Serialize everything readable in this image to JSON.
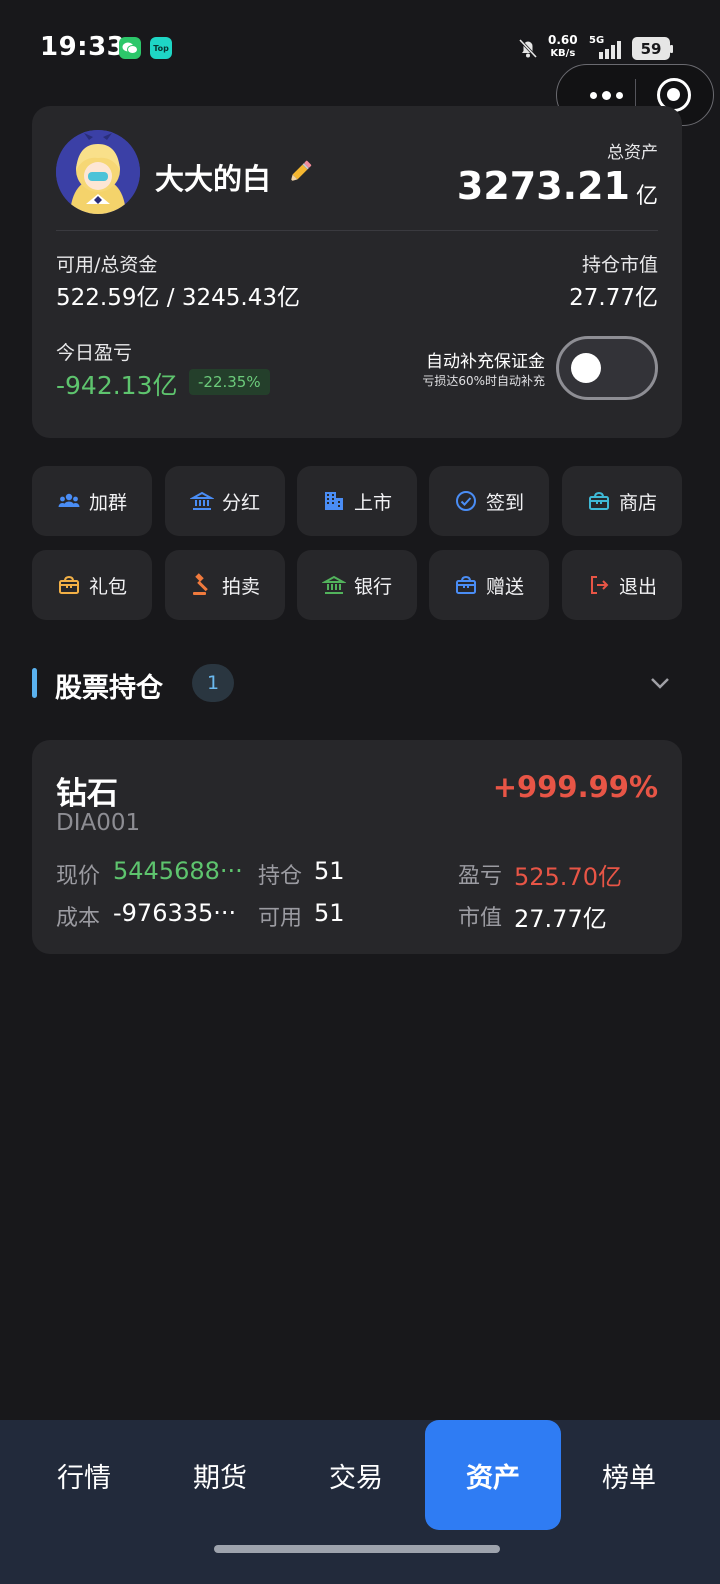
{
  "status_bar": {
    "time": "19:33",
    "wechat_icon": "wechat-icon",
    "top_badge": "Top",
    "net_speed_value": "0.60",
    "net_speed_unit": "KB/s",
    "network": "5G",
    "battery": "59"
  },
  "account": {
    "username": "大大的白",
    "total_assets_label": "总资产",
    "total_assets_value": "3273.21",
    "total_assets_unit": "亿",
    "available_label": "可用/总资金",
    "available_value": "522.59亿 / 3245.43亿",
    "holding_label": "持仓市值",
    "holding_value": "27.77亿",
    "today_label": "今日盈亏",
    "today_value": "-942.13亿",
    "today_pct": "-22.35%",
    "auto_margin_title": "自动补充保证金",
    "auto_margin_sub": "亏损达60%时自动补充",
    "auto_margin_on": false
  },
  "actions": [
    {
      "label": "加群",
      "icon": "group-icon",
      "color": "#4a8df5"
    },
    {
      "label": "分红",
      "icon": "bank-icon",
      "color": "#4a8df5"
    },
    {
      "label": "上市",
      "icon": "building-icon",
      "color": "#4a8df5"
    },
    {
      "label": "签到",
      "icon": "check-circle-icon",
      "color": "#4a8df5"
    },
    {
      "label": "商店",
      "icon": "shop-icon",
      "color": "#3fb9d6"
    },
    {
      "label": "礼包",
      "icon": "gift-icon",
      "color": "#f2b046"
    },
    {
      "label": "拍卖",
      "icon": "gavel-icon",
      "color": "#f07a3d"
    },
    {
      "label": "银行",
      "icon": "bank-icon",
      "color": "#52b35c"
    },
    {
      "label": "赠送",
      "icon": "present-icon",
      "color": "#4a8df5"
    },
    {
      "label": "退出",
      "icon": "logout-icon",
      "color": "#e85546"
    }
  ],
  "holdings_section": {
    "title": "股票持仓",
    "count": "1"
  },
  "stock": {
    "name": "钻石",
    "code": "DIA001",
    "change_pct": "+999.99%",
    "price_label": "现价",
    "price_value": "5445688···",
    "position_label": "持仓",
    "position_value": "51",
    "pnl_label": "盈亏",
    "pnl_value": "525.70亿",
    "cost_label": "成本",
    "cost_value": "-976335···",
    "available_label": "可用",
    "available_value": "51",
    "market_value_label": "市值",
    "market_value_value": "27.77亿"
  },
  "tabs": [
    {
      "label": "行情",
      "active": false
    },
    {
      "label": "期货",
      "active": false
    },
    {
      "label": "交易",
      "active": false
    },
    {
      "label": "资产",
      "active": true
    },
    {
      "label": "榜单",
      "active": false
    }
  ],
  "colors": {
    "background": "#18181b",
    "card": "#27272a",
    "accent": "#2f7cf3",
    "gain": "#e85546",
    "loss": "#5ec46e"
  }
}
